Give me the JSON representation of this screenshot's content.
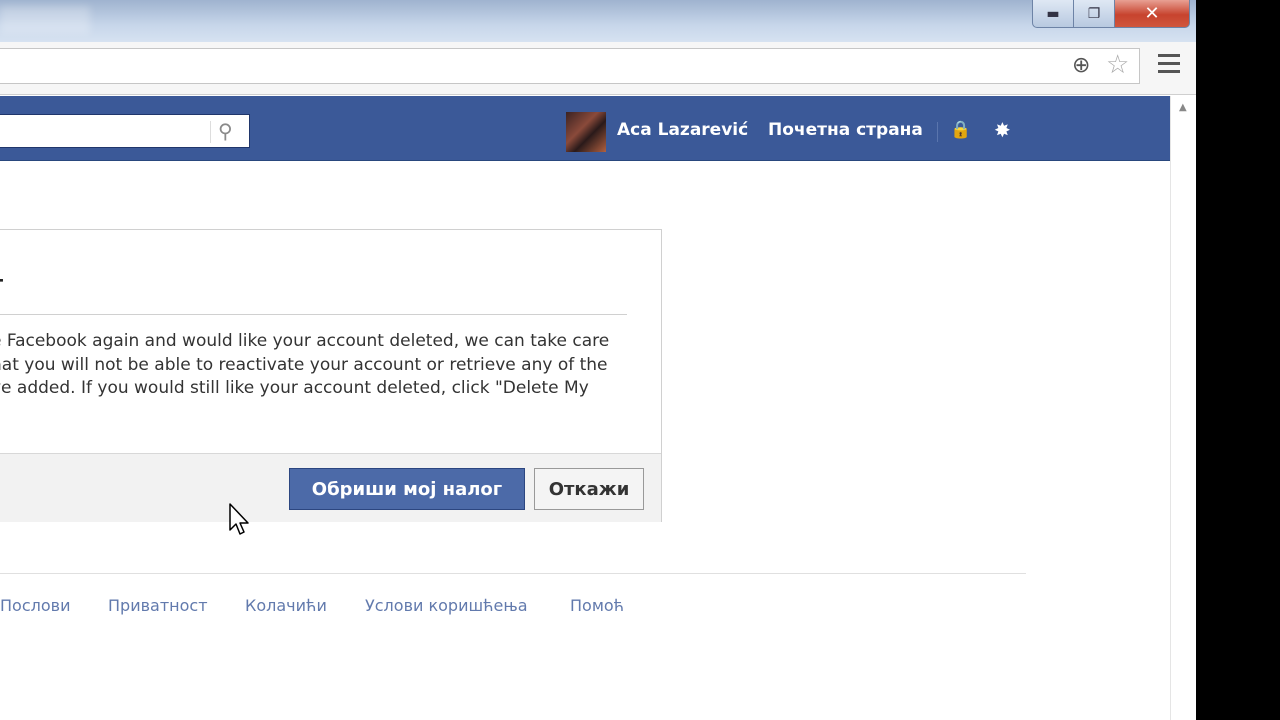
{
  "window": {
    "controls": {
      "minimize": "▬",
      "maximize": "❐",
      "close": "✕"
    }
  },
  "browser": {
    "icons": [
      "zoom-icon",
      "bookmark-star-icon",
      "menu-icon"
    ],
    "zoom_glyph": "⊕",
    "star_glyph": "☆"
  },
  "facebook_bar": {
    "search_icon": "⚲",
    "user_name": "Aca Lazarević",
    "home_link": "Почетна страна",
    "privacy_icon": "🔒",
    "settings_icon": "✸",
    "bar_color": "#3b5998"
  },
  "dialog": {
    "title": "г",
    "body_lines": [
      "е Facebook again and would like your account deleted, we can take care",
      "hat you will not be able to reactivate your account or retrieve any of the",
      "ve added. If you would still like your account deleted, click \"Delete My"
    ],
    "confirm_label": "Обриши мој налог",
    "cancel_label": "Откажи",
    "confirm_color": "#4c6aa8"
  },
  "footer": {
    "links": [
      "Послови",
      "Приватност",
      "Колачићи",
      "Услови коришћења",
      "Помоћ"
    ]
  }
}
